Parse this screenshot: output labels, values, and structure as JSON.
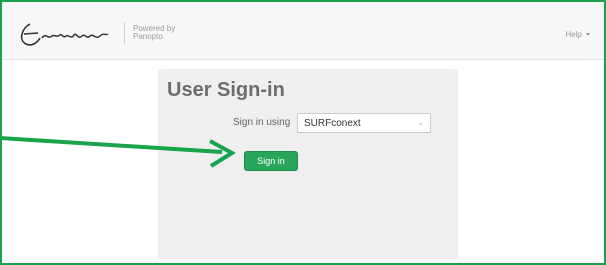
{
  "header": {
    "logo_name": "erasmus-logo",
    "powered_by_line1": "Powered by",
    "powered_by_line2": "Panopto",
    "help_label": "Help"
  },
  "panel": {
    "title": "User Sign-in",
    "sign_in_using_label": "Sign in using",
    "provider_selected": "SURFconext",
    "sign_in_button": "Sign in"
  },
  "colors": {
    "frame_border": "#19a34a",
    "annotation_arrow": "#19a34a",
    "sign_in_button": "#28a55b",
    "panel_bg": "#efefef"
  }
}
